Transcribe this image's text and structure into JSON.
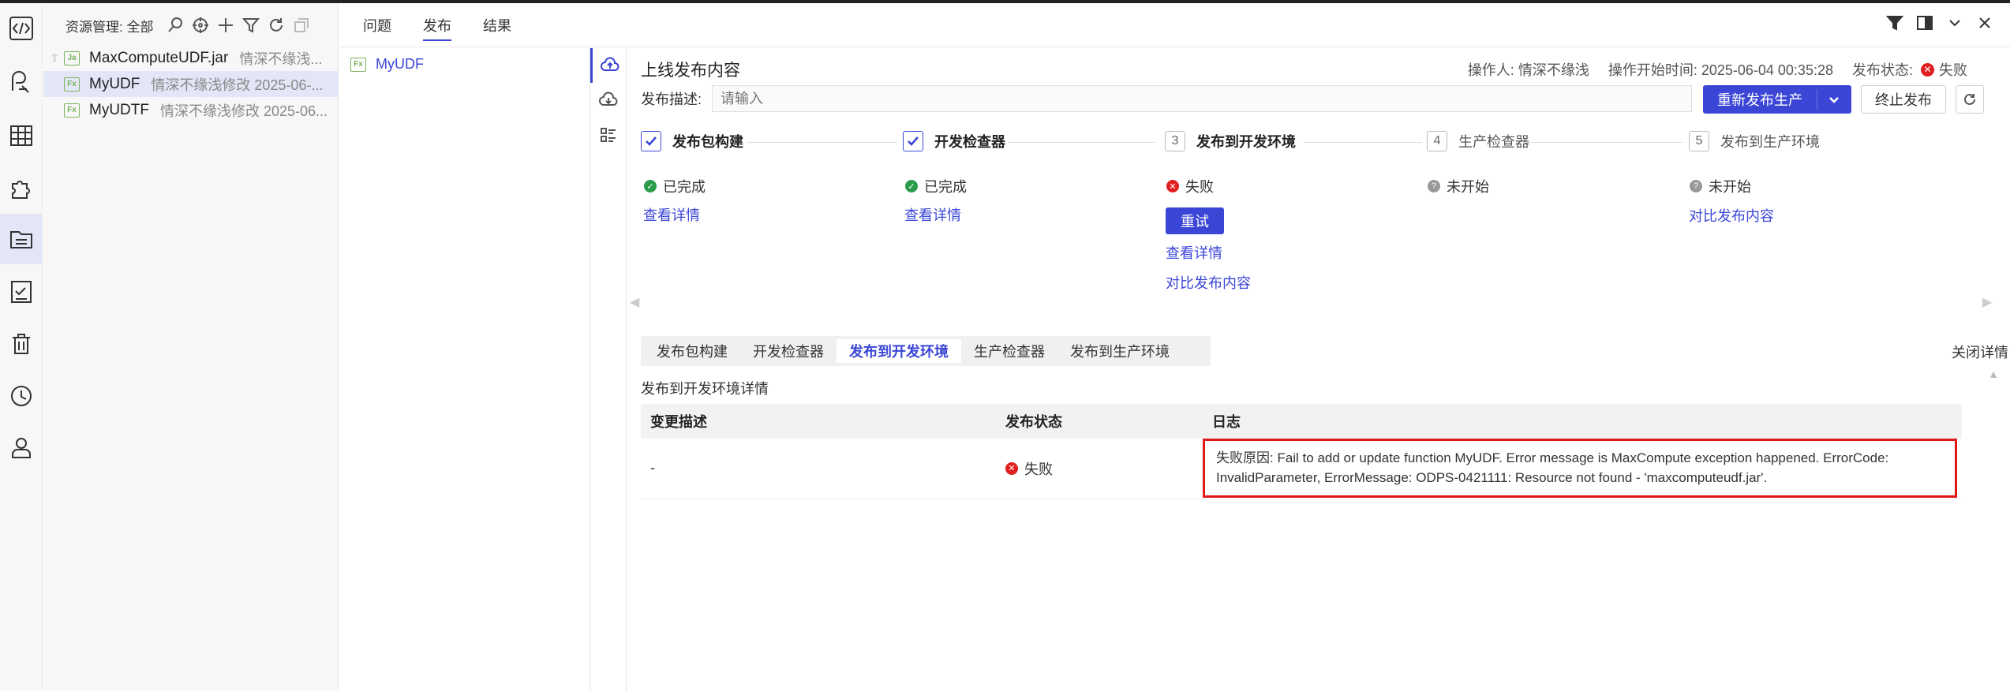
{
  "resource_panel": {
    "title": "资源管理: 全部",
    "files": [
      {
        "name": "MaxComputeUDF.jar",
        "meta": "情深不缘浅...",
        "badge": "Ja"
      },
      {
        "name": "MyUDF",
        "meta": "情深不缘浅修改 2025-06-...",
        "badge": "Fx"
      },
      {
        "name": "MyUDTF",
        "meta": "情深不缘浅修改 2025-06...",
        "badge": "Fx"
      }
    ]
  },
  "header_tabs": [
    {
      "label": "问题"
    },
    {
      "label": "发布"
    },
    {
      "label": "结果"
    }
  ],
  "udf_list": {
    "item": {
      "badge": "Fx",
      "name": "MyUDF"
    }
  },
  "publish": {
    "title": "上线发布内容",
    "operator": "操作人: 情深不缘浅",
    "start_time": "操作开始时间: 2025-06-04 00:35:28",
    "status_label": "发布状态:",
    "status_value": "失败",
    "desc_label": "发布描述:",
    "desc_placeholder": "请输入",
    "btn_republish": "重新发布生产",
    "btn_stop": "终止发布"
  },
  "steps": [
    {
      "num": "",
      "label": "发布包构建",
      "state": "已完成",
      "state_type": "ok",
      "links": [
        "查看详情"
      ]
    },
    {
      "num": "",
      "label": "开发检查器",
      "state": "已完成",
      "state_type": "ok",
      "links": [
        "查看详情"
      ]
    },
    {
      "num": "3",
      "label": "发布到开发环境",
      "state": "失败",
      "state_type": "err",
      "retry": "重试",
      "links": [
        "查看详情",
        "对比发布内容"
      ]
    },
    {
      "num": "4",
      "label": "生产检查器",
      "state": "未开始",
      "state_type": "na",
      "links": []
    },
    {
      "num": "5",
      "label": "发布到生产环境",
      "state": "未开始",
      "state_type": "na",
      "links": [
        "对比发布内容"
      ]
    }
  ],
  "detail_tabs": [
    "发布包构建",
    "开发检查器",
    "发布到开发环境",
    "生产检查器",
    "发布到生产环境"
  ],
  "close_detail": "关闭详情",
  "detail_title": "发布到开发环境详情",
  "table": {
    "headers": [
      "变更描述",
      "发布状态",
      "日志"
    ],
    "row": {
      "desc": "-",
      "status": "失败",
      "log": "失败原因: Fail to add or update function MyUDF. Error message is MaxCompute exception happened. ErrorCode: InvalidParameter, ErrorMessage: ODPS-0421111: Resource not found - 'maxcomputeudf.jar'."
    }
  },
  "colors": {
    "accent": "#3b46d6",
    "error": "#e02020",
    "success": "#2a9d4a",
    "highlight_border": "#e01818"
  }
}
